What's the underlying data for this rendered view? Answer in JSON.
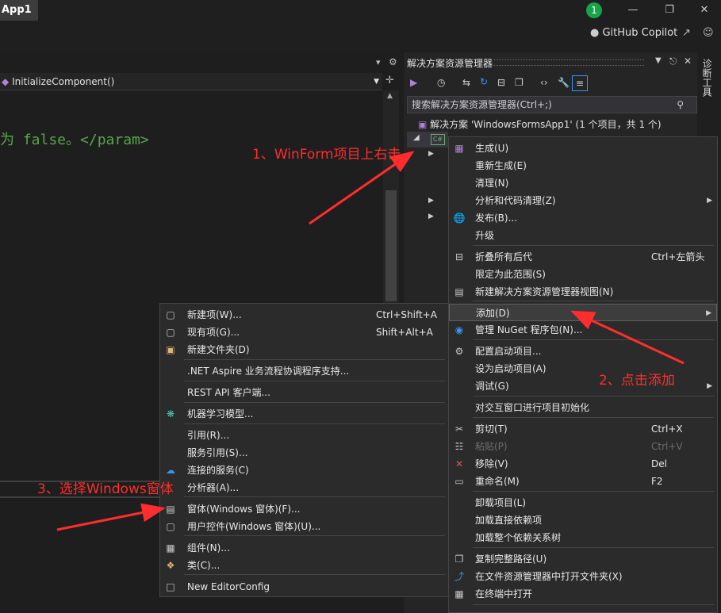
{
  "app": {
    "title": "App1",
    "notification_count": "1",
    "copilot_label": "GitHub Copilot"
  },
  "editor": {
    "nav_member": "InitializeComponent()",
    "code_text": "为 false。</param>"
  },
  "solution_explorer": {
    "title": "解决方案资源管理器",
    "search_placeholder": "搜索解决方案资源管理器(Ctrl+;)",
    "solution_label": "解决方案 'WindowsFormsApp1' (1 个项目，共 1 个)",
    "side_tab": "诊断工具"
  },
  "project_menu": [
    {
      "label": "生成(U)",
      "icon": "build-icon"
    },
    {
      "label": "重新生成(E)"
    },
    {
      "label": "清理(N)"
    },
    {
      "label": "分析和代码清理(Z)",
      "submenu": true
    },
    {
      "label": "发布(B)...",
      "icon": "globe-icon"
    },
    {
      "label": "升级"
    },
    {
      "label": "折叠所有后代",
      "shortcut": "Ctrl+左箭头",
      "icon": "collapse-icon"
    },
    {
      "label": "限定为此范围(S)"
    },
    {
      "label": "新建解决方案资源管理器视图(N)",
      "icon": "new-view-icon"
    },
    {
      "label": "添加(D)",
      "submenu": true,
      "highlight": true
    },
    {
      "label": "管理 NuGet 程序包(N)...",
      "icon": "nuget-icon"
    },
    {
      "label": "配置启动项目...",
      "icon": "gear-icon"
    },
    {
      "label": "设为启动项目(A)"
    },
    {
      "label": "调试(G)",
      "submenu": true
    },
    {
      "label": "对交互窗口进行项目初始化"
    },
    {
      "label": "剪切(T)",
      "shortcut": "Ctrl+X",
      "icon": "scissors-icon"
    },
    {
      "label": "粘贴(P)",
      "shortcut": "Ctrl+V",
      "icon": "paste-icon",
      "disabled": true
    },
    {
      "label": "移除(V)",
      "shortcut": "Del",
      "icon": "remove-icon"
    },
    {
      "label": "重命名(M)",
      "shortcut": "F2",
      "icon": "rename-icon"
    },
    {
      "label": "卸载项目(L)"
    },
    {
      "label": "加载直接依赖项"
    },
    {
      "label": "加载整个依赖关系树"
    },
    {
      "label": "复制完整路径(U)",
      "icon": "copy-icon"
    },
    {
      "label": "在文件资源管理器中打开文件夹(X)",
      "icon": "open-folder-icon"
    },
    {
      "label": "在终端中打开",
      "icon": "terminal-icon"
    }
  ],
  "add_menu": [
    {
      "label": "新建项(W)...",
      "shortcut": "Ctrl+Shift+A",
      "icon": "new-item-icon"
    },
    {
      "label": "现有项(G)...",
      "shortcut": "Shift+Alt+A",
      "icon": "existing-item-icon"
    },
    {
      "label": "新建文件夹(D)",
      "icon": "folder-icon"
    },
    {
      "label": ".NET Aspire 业务流程协调程序支持..."
    },
    {
      "label": "REST API 客户端..."
    },
    {
      "label": "机器学习模型...",
      "icon": "ml-icon"
    },
    {
      "label": "引用(R)..."
    },
    {
      "label": "服务引用(S)..."
    },
    {
      "label": "连接的服务(C)",
      "icon": "connected-service-icon"
    },
    {
      "label": "分析器(A)..."
    },
    {
      "label": "窗体(Windows 窗体)(F)...",
      "icon": "form-icon"
    },
    {
      "label": "用户控件(Windows 窗体)(U)...",
      "icon": "user-control-icon"
    },
    {
      "label": "组件(N)...",
      "icon": "component-icon"
    },
    {
      "label": "类(C)...",
      "icon": "class-icon"
    },
    {
      "label": "New EditorConfig",
      "icon": "file-icon"
    }
  ],
  "annotations": {
    "step1": "1、WinForm项目上右击",
    "step2": "2、点击添加",
    "step3": "3、选择Windows窗体"
  },
  "colors": {
    "annotation": "#ff2d2d",
    "menu_bg": "#2b2b2b",
    "accent": "#3794ff"
  }
}
